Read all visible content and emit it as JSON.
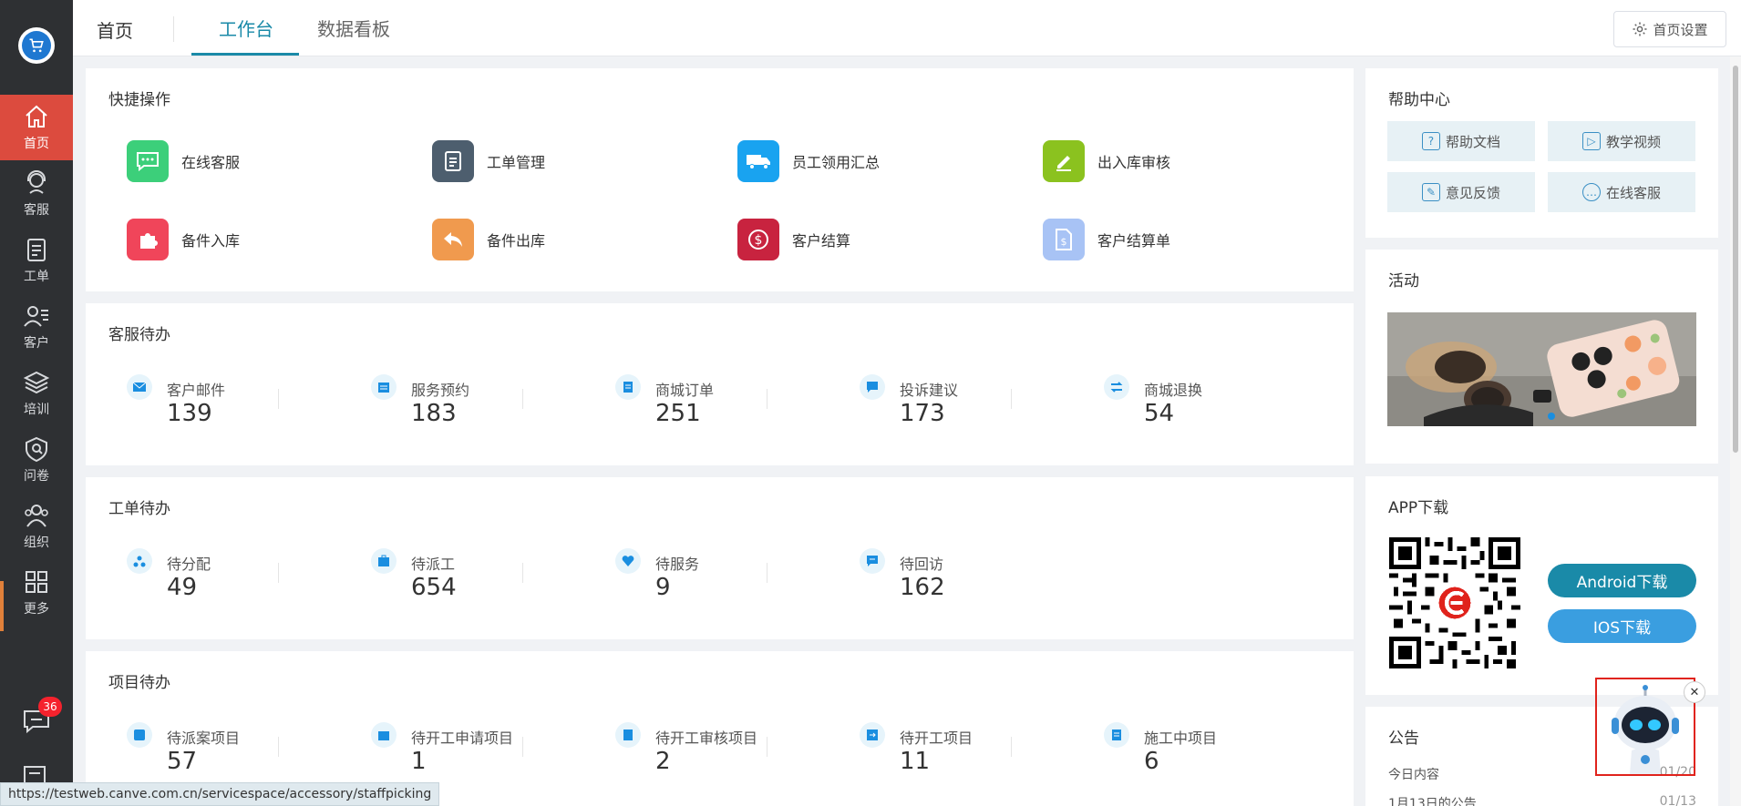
{
  "sidebar": {
    "logo_icon": "cart-icon",
    "items": [
      {
        "label": "首页",
        "icon": "home-icon"
      },
      {
        "label": "客服",
        "icon": "headset-icon"
      },
      {
        "label": "工单",
        "icon": "clipboard-icon"
      },
      {
        "label": "客户",
        "icon": "customer-icon"
      },
      {
        "label": "培训",
        "icon": "layers-icon"
      },
      {
        "label": "问卷",
        "icon": "survey-icon"
      },
      {
        "label": "组织",
        "icon": "people-icon"
      },
      {
        "label": "更多",
        "icon": "grid-icon"
      }
    ],
    "chat_badge": "36"
  },
  "topbar": {
    "home": "首页",
    "tabs": [
      "工作台",
      "数据看板"
    ],
    "settings_label": "首页设置"
  },
  "quick_actions": {
    "title": "快捷操作",
    "items": [
      {
        "label": "在线客服",
        "color": "#3ccf7a"
      },
      {
        "label": "工单管理",
        "color": "#4d5e6e"
      },
      {
        "label": "员工领用汇总",
        "color": "#19a3f0"
      },
      {
        "label": "出入库审核",
        "color": "#8bc21f"
      },
      {
        "label": "备件入库",
        "color": "#f0455a"
      },
      {
        "label": "备件出库",
        "color": "#f09a4e"
      },
      {
        "label": "客户结算",
        "color": "#c8233f"
      },
      {
        "label": "客户结算单",
        "color": "#a8c3f5"
      }
    ]
  },
  "service_todo": {
    "title": "客服待办",
    "items": [
      {
        "label": "客户邮件",
        "count": "139"
      },
      {
        "label": "服务预约",
        "count": "183"
      },
      {
        "label": "商城订单",
        "count": "251"
      },
      {
        "label": "投诉建议",
        "count": "173"
      },
      {
        "label": "商城退换",
        "count": "54"
      }
    ]
  },
  "workorder_todo": {
    "title": "工单待办",
    "items": [
      {
        "label": "待分配",
        "count": "49"
      },
      {
        "label": "待派工",
        "count": "654"
      },
      {
        "label": "待服务",
        "count": "9"
      },
      {
        "label": "待回访",
        "count": "162"
      }
    ]
  },
  "project_todo": {
    "title": "项目待办",
    "items": [
      {
        "label": "待派案项目",
        "count": "57"
      },
      {
        "label": "待开工申请项目",
        "count": "1"
      },
      {
        "label": "待开工审核项目",
        "count": "2"
      },
      {
        "label": "待开工项目",
        "count": "11"
      },
      {
        "label": "施工中项目",
        "count": "6"
      }
    ]
  },
  "help": {
    "title": "帮助中心",
    "items": [
      "帮助文档",
      "教学视频",
      "意见反馈",
      "在线客服"
    ]
  },
  "activity": {
    "title": "活动"
  },
  "app_download": {
    "title": "APP下载",
    "android_label": "Android下载",
    "ios_label": "IOS下载",
    "android_color": "#1a8aa8",
    "ios_color": "#3a9ee0"
  },
  "notice": {
    "title": "公告",
    "rows": [
      {
        "text": "今日内容",
        "date": "01/20"
      },
      {
        "text": "1月13日的公告",
        "date": "01/13"
      }
    ]
  },
  "status_url": "https://testweb.canve.com.cn/servicespace/accessory/staffpicking",
  "colors": {
    "sidebar_bg": "#2e3033",
    "active_nav": "#dc4b3e",
    "accent": "#1a8aa8"
  }
}
